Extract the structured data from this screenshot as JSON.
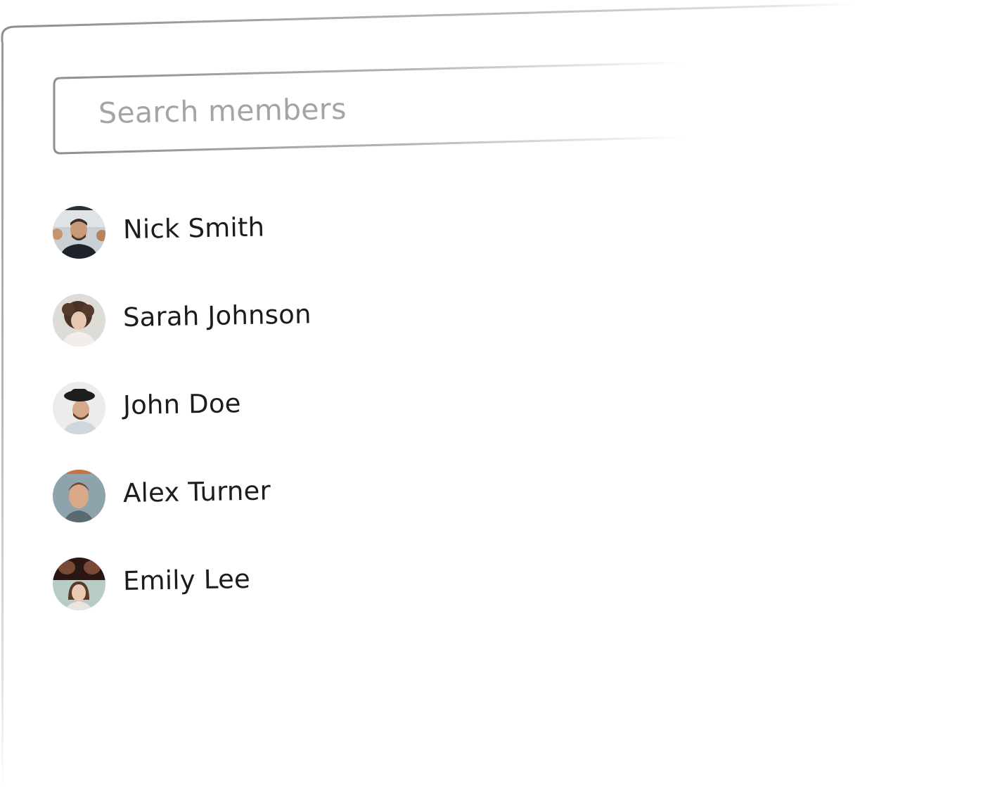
{
  "search": {
    "placeholder": "Search members"
  },
  "members": [
    {
      "name": "Nick Smith",
      "avatar": "nick-smith-avatar"
    },
    {
      "name": "Sarah Johnson",
      "avatar": "sarah-johnson-avatar"
    },
    {
      "name": "John Doe",
      "avatar": "john-doe-avatar"
    },
    {
      "name": "Alex Turner",
      "avatar": "alex-turner-avatar"
    },
    {
      "name": "Emily Lee",
      "avatar": "emily-lee-avatar"
    }
  ],
  "colors": {
    "border": "#9a9a9a",
    "placeholder": "#a4a4a4",
    "name_text": "#1c1c1c",
    "background": "#ffffff"
  }
}
